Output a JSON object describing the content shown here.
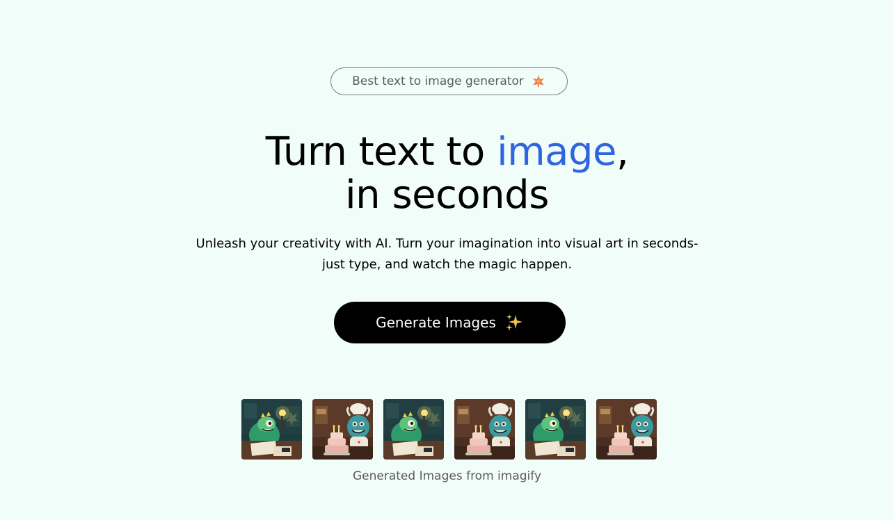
{
  "badge": {
    "label": "Best text to image generator",
    "icon": "star-icon",
    "icon_color": "#f07b3a"
  },
  "hero": {
    "title_line1_pre": "Turn text to ",
    "title_line1_accent": "image",
    "title_line1_post": ",",
    "title_line2": "in seconds",
    "accent_color": "#2e66e0",
    "subtitle_line1": "Unleash your creativity with AI. Turn your imagination into visual art in seconds-",
    "subtitle_line2": "just type, and watch the magic happen."
  },
  "cta": {
    "label": "Generate Images",
    "icon": "sparkle-icon"
  },
  "gallery": {
    "images": [
      {
        "subject": "monster-with-lamp"
      },
      {
        "subject": "monster-chef-with-cake"
      },
      {
        "subject": "monster-with-lamp"
      },
      {
        "subject": "monster-chef-with-cake"
      },
      {
        "subject": "monster-with-lamp"
      },
      {
        "subject": "monster-chef-with-cake"
      }
    ],
    "caption": "Generated Images from imagify"
  },
  "colors": {
    "background": "#f1fdf8",
    "button": "#000000",
    "text_muted": "#5b5b5b"
  }
}
